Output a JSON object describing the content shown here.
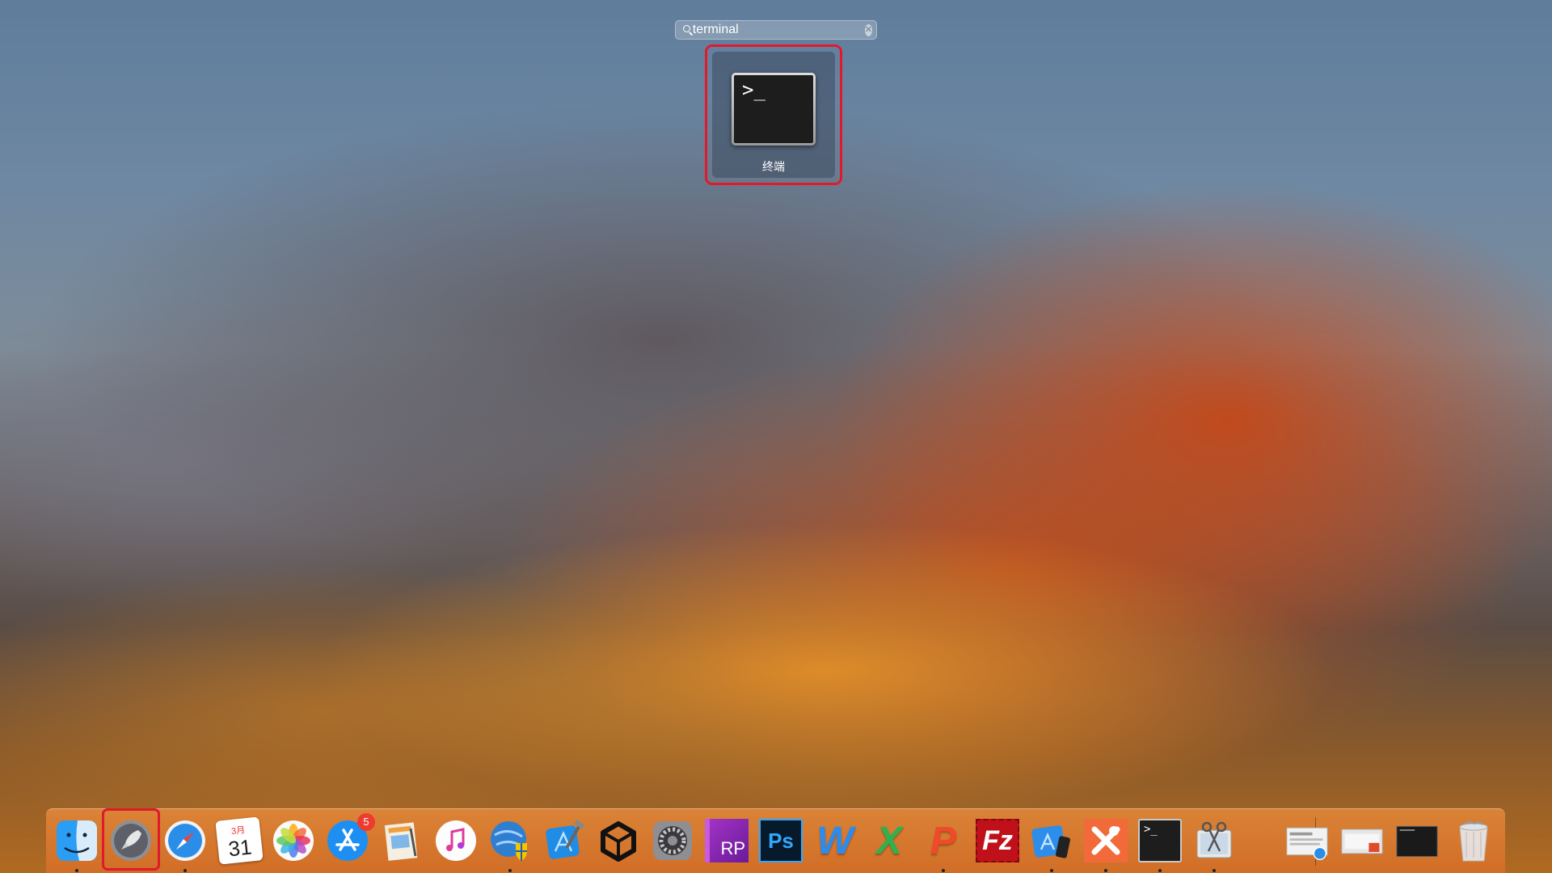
{
  "search": {
    "query": "terminal"
  },
  "result": {
    "app_name": "终端",
    "icon": "terminal-icon",
    "prompt": ">_"
  },
  "dock": {
    "items": [
      {
        "name": "finder",
        "icon": "finder-icon",
        "running": true
      },
      {
        "name": "launchpad",
        "icon": "rocket-icon",
        "running": false,
        "highlighted": true
      },
      {
        "name": "safari",
        "icon": "compass-icon",
        "running": true
      },
      {
        "name": "calendar",
        "icon": "calendar-icon",
        "month": "3月",
        "day": "31",
        "running": false
      },
      {
        "name": "photos",
        "icon": "photos-icon",
        "running": false
      },
      {
        "name": "app-store",
        "icon": "app-store-icon",
        "badge": "5",
        "running": false
      },
      {
        "name": "preview",
        "icon": "preview-icon",
        "running": false
      },
      {
        "name": "itunes",
        "icon": "music-note-icon",
        "running": false
      },
      {
        "name": "network-app",
        "icon": "globe-shield-icon",
        "running": true
      },
      {
        "name": "xcode",
        "icon": "hammer-icon",
        "running": false
      },
      {
        "name": "unity",
        "icon": "unity-icon",
        "running": false
      },
      {
        "name": "system-preferences",
        "icon": "gear-icon",
        "running": false
      },
      {
        "name": "axure-rp",
        "icon": "rp-icon",
        "label": "RP",
        "running": false
      },
      {
        "name": "photoshop",
        "icon": "ps-icon",
        "label": "Ps",
        "running": false
      },
      {
        "name": "word",
        "icon": "w-icon",
        "label": "W",
        "running": false
      },
      {
        "name": "excel",
        "icon": "x-icon",
        "label": "X",
        "running": false
      },
      {
        "name": "powerpoint",
        "icon": "p-icon",
        "label": "P",
        "running": true
      },
      {
        "name": "filezilla",
        "icon": "fz-icon",
        "label": "Fz",
        "running": false
      },
      {
        "name": "simulator",
        "icon": "simulator-icon",
        "running": true
      },
      {
        "name": "xmind",
        "icon": "xmind-icon",
        "running": true
      },
      {
        "name": "terminal",
        "icon": "terminal-icon",
        "label": ">_",
        "running": true
      },
      {
        "name": "screenshot-tool",
        "icon": "scissors-icon",
        "running": true
      },
      {
        "name": "minimized-window-1",
        "icon": "window-thumbnail-icon",
        "running": false
      },
      {
        "name": "minimized-window-2",
        "icon": "window-thumbnail-icon",
        "running": false
      },
      {
        "name": "minimized-window-3",
        "icon": "window-thumbnail-icon",
        "running": false
      },
      {
        "name": "trash",
        "icon": "trash-icon",
        "running": false
      }
    ]
  },
  "colors": {
    "highlight": "#e11a2b",
    "dock": "#e08840",
    "badge": "#ee3b30"
  }
}
